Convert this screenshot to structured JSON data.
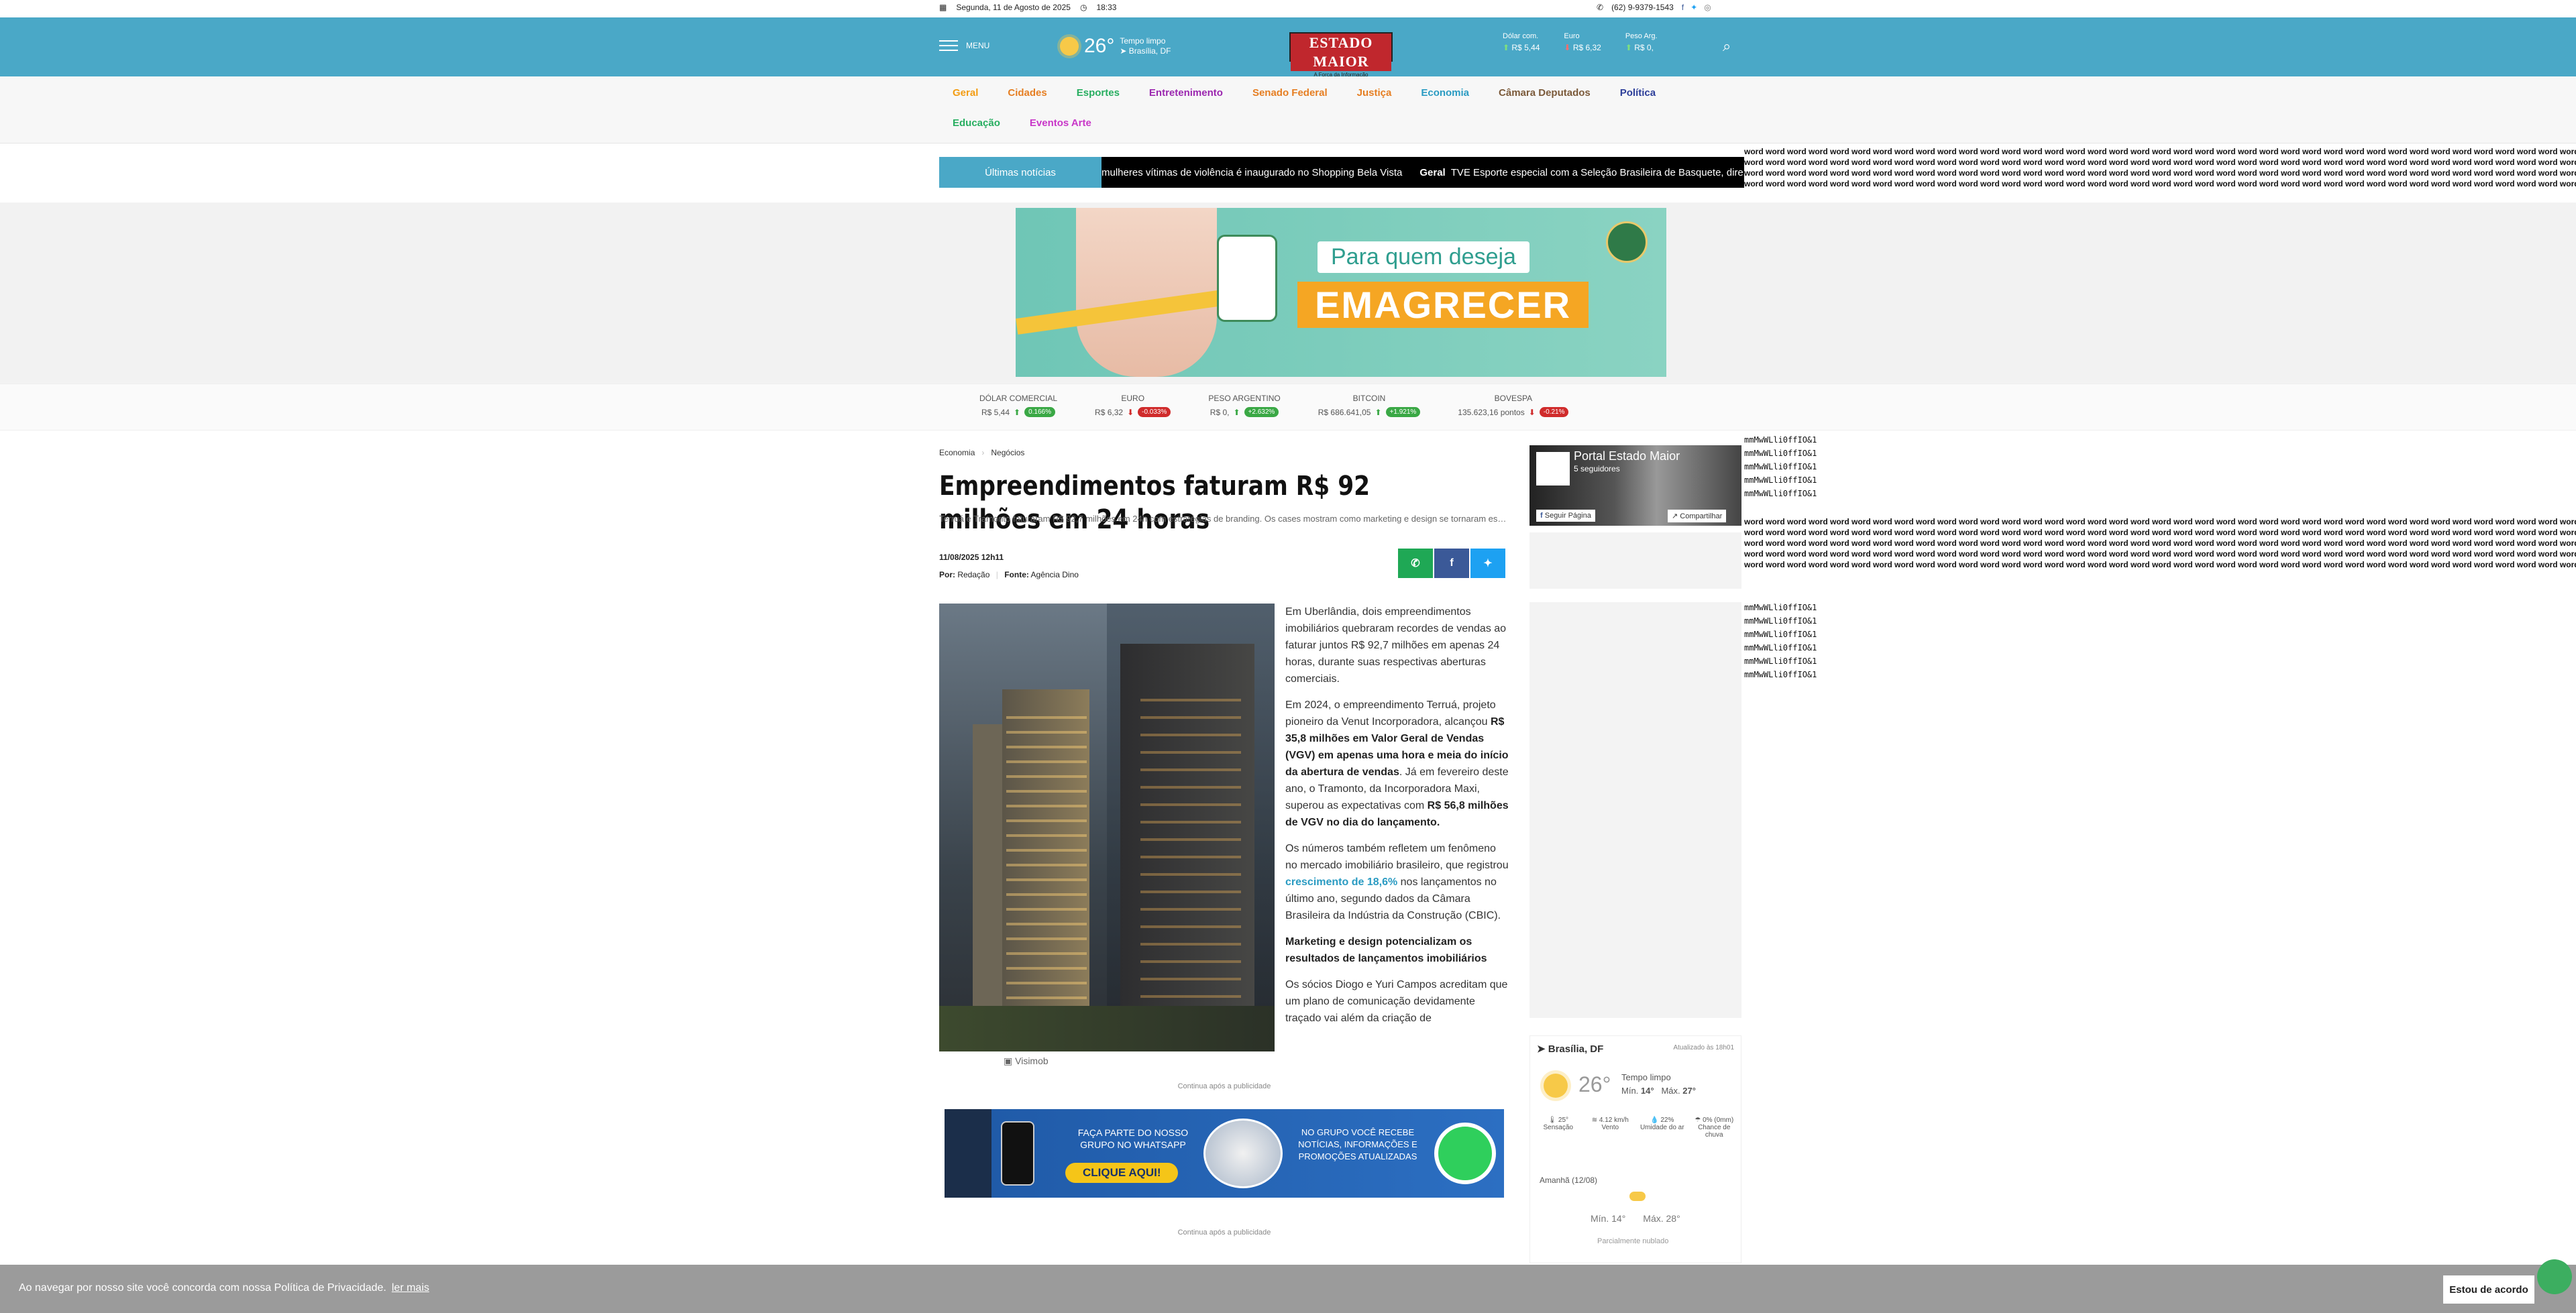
{
  "topbar": {
    "date": "Segunda, 11 de Agosto de 2025",
    "time": "18:33",
    "phone": "(62) 9-9379-1543",
    "social": [
      "facebook-icon",
      "twitter-icon",
      "instagram-icon"
    ]
  },
  "header": {
    "menu_label": "MENU",
    "weather": {
      "temp": "26°",
      "desc": "Tempo limpo",
      "city": "Brasília, DF"
    },
    "logo_text": "ESTADO MAIOR",
    "logo_tagline": "A Força da Informação",
    "currencies": [
      {
        "label": "Dólar com.",
        "value": "R$ 5,44",
        "trend": "up"
      },
      {
        "label": "Euro",
        "value": "R$ 6,32",
        "trend": "down"
      },
      {
        "label": "Peso Arg.",
        "value": "R$ 0,",
        "trend": "up"
      }
    ]
  },
  "nav": [
    {
      "label": "Geral",
      "color": "#f39c12"
    },
    {
      "label": "Cidades",
      "color": "#e67e22"
    },
    {
      "label": "Esportes",
      "color": "#27ae60"
    },
    {
      "label": "Entretenimento",
      "color": "#9b27af"
    },
    {
      "label": "Senado Federal",
      "color": "#e67e22"
    },
    {
      "label": "Justiça",
      "color": "#e67e22"
    },
    {
      "label": "Economia",
      "color": "#2a9bc2"
    },
    {
      "label": "Câmara Deputados",
      "color": "#7b5a3a"
    },
    {
      "label": "Política",
      "color": "#2c3e99"
    },
    {
      "label": "Educação",
      "color": "#27ae60"
    },
    {
      "label": "Eventos Arte",
      "color": "#c837c8"
    }
  ],
  "ticker": {
    "label": "Últimas notícias",
    "items": [
      {
        "cat": "",
        "text": "mulheres vítimas de violência é inaugurado no Shopping Bela Vista"
      },
      {
        "cat": "Geral",
        "text": "TVE Esporte especial com a Seleção Brasileira de Basquete, dire"
      }
    ]
  },
  "filler": {
    "word_line": "word word word word word word word word word word word word word word word word word word word word word word word word word word word word word word word word word word word word word word word word word word word word word word word word word word word word word word word word word word word word word word word word word word word word word word word word word",
    "mono_lines": [
      "mmMwWLli0ffIO&1",
      "mmMwWLli0ffIO&1",
      "mmMwWLli0ffIO&1",
      "mmMwWLli0ffIO&1",
      "mmMwWLli0ffIO&1",
      "mmMwWLli0ffIO&1"
    ]
  },
  "banner": {
    "line1": "Para quem deseja",
    "line2": "EMAGRECER"
  },
  "quotes": [
    {
      "name": "DÓLAR COMERCIAL",
      "value": "R$ 5,44",
      "trend": "up",
      "change": "0.166%",
      "pill": "#3aa845"
    },
    {
      "name": "EURO",
      "value": "R$ 6,32",
      "trend": "down",
      "change": "-0.033%",
      "pill": "#d02b2b"
    },
    {
      "name": "PESO ARGENTINO",
      "value": "R$ 0,",
      "trend": "up",
      "change": "+2.632%",
      "pill": "#3aa845"
    },
    {
      "name": "BITCOIN",
      "value": "R$ 686.641,05",
      "trend": "up",
      "change": "+1.921%",
      "pill": "#3aa845"
    },
    {
      "name": "BOVESPA",
      "value": "135.623,16 pontos",
      "trend": "down",
      "change": "-0.21%",
      "pill": "#d02b2b"
    }
  ],
  "article": {
    "crumbs": [
      "Economia",
      "Negócios"
    ],
    "title": "Empreendimentos faturam R$ 92 milhões em 24 horas",
    "subtitle": "Terruá e Tramonto faturaram R$ 92,7 milhões em 24h com estratégias de branding. Os cases mostram como marketing e design se tornaram essenciais par...",
    "date": "11/08/2025 12h11",
    "by_label": "Por:",
    "by": "Redação",
    "source_label": "Fonte:",
    "source": "Agência Dino",
    "caption": "Visimob",
    "p1": "Em Uberlândia, dois empreendimentos imobiliários quebraram recordes de vendas ao faturar juntos R$ 92,7 milhões em apenas 24 horas, durante suas respectivas aberturas comerciais.",
    "p2a": "Em 2024, o empreendimento Terruá, projeto pioneiro da Venut Incorporadora, alcançou ",
    "p2b": "R$ 35,8 milhões em Valor Geral de Vendas (VGV) em apenas uma hora e meia do início da abertura de vendas",
    "p2c": ". Já em fevereiro deste ano, o Tramonto, da Incorporadora Maxi, superou as expectativas com ",
    "p2d": "R$ 56,8 milhões de VGV no dia do lançamento.",
    "p3a": "Os números também refletem um fenômeno no mercado imobiliário brasileiro, que registrou ",
    "p3b": "crescimento de 18,6%",
    "p3c": " nos lançamentos no último ano, segundo dados da Câmara Brasileira da Indústria da Construção (CBIC).",
    "h2": "Marketing e design potencializam os resultados de lançamentos imobiliários",
    "p4": "Os sócios Diogo e Yuri Campos acreditam que um plano de comunicação devidamente traçado vai além da criação de",
    "continue": "Continua após a publicidade"
  },
  "wa_banner": {
    "t1": "FAÇA PARTE DO NOSSO GRUPO NO WHATSAPP",
    "btn": "CLIQUE AQUI!",
    "t2": "NO GRUPO VOCÊ RECEBE NOTÍCIAS, INFORMAÇÕES E PROMOÇÕES ATUALIZADAS"
  },
  "facebook": {
    "name": "Portal Estado Maior",
    "followers": "5 seguidores",
    "follow": "Seguir Página",
    "share": "Compartilhar"
  },
  "weather_widget": {
    "location": "Brasília, DF",
    "updated": "Atualizado às 18h01",
    "temp": "26°",
    "desc": "Tempo limpo",
    "min_label": "Mín.",
    "min": "14°",
    "max_label": "Máx.",
    "max": "27°",
    "stats": [
      {
        "v": "25°",
        "l": "Sensação"
      },
      {
        "v": "4.12 km/h",
        "l": "Vento"
      },
      {
        "v": "22%",
        "l": "Umidade do ar"
      },
      {
        "v": "0% (0mm)",
        "l": "Chance de chuva"
      }
    ],
    "tomorrow": "Amanhã (12/08)",
    "t_min": "Mín. 14°",
    "t_max": "Máx. 28°",
    "t_desc": "Parcialmente nublado"
  },
  "cookie": {
    "msg": "Ao navegar por nosso site você concorda com nossa Política de Privacidade.",
    "link": "ler mais",
    "accept": "Estou de acordo"
  },
  "colors": {
    "brand": "#4aa8c7",
    "whatsapp": "#1fa855",
    "facebook": "#3b5998",
    "twitter": "#1da1f2"
  }
}
